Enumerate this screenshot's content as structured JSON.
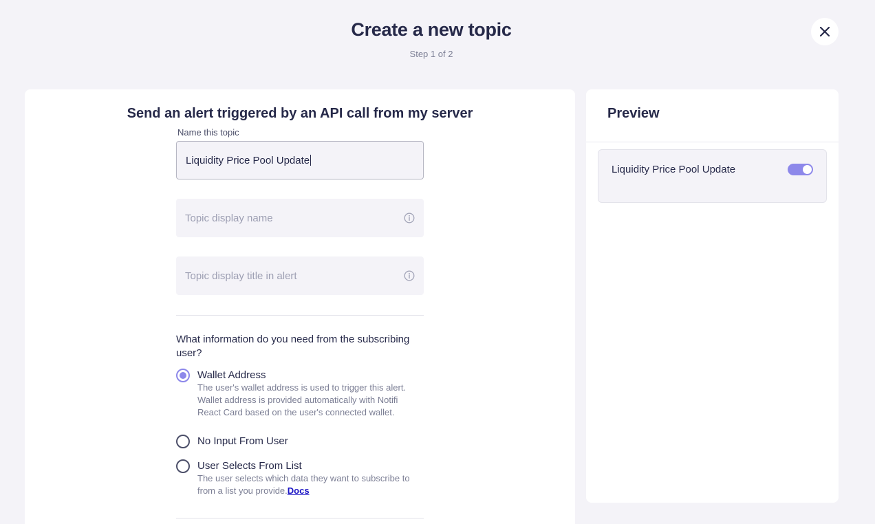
{
  "header": {
    "title": "Create a new topic",
    "step": "Step 1 of 2",
    "close_icon": "close-icon"
  },
  "form": {
    "title": "Send an alert triggered by an API call from my server",
    "name_label": "Name this topic",
    "name_value": "Liquidity Price Pool Update",
    "display_name_placeholder": "Topic display name",
    "display_title_placeholder": "Topic display title in alert",
    "info_icon": "info-icon",
    "question": "What information do you need from the subscribing user?",
    "options": [
      {
        "label": "Wallet Address",
        "desc_lines": [
          "The user's wallet address is used to trigger this alert.",
          "Wallet address is provided automatically with Notifi",
          "React Card based on the user's connected wallet."
        ],
        "checked": true
      },
      {
        "label": "No Input From User",
        "checked": false
      },
      {
        "label": "User Selects From List",
        "desc_lines": [
          "The user selects which data they want to subscribe to",
          "from a list you provide."
        ],
        "link": "Docs",
        "checked": false
      }
    ]
  },
  "preview": {
    "title": "Preview",
    "item_label": "Liquidity Price Pool Update",
    "toggle_on": true
  },
  "colors": {
    "accent": "#8d88ea",
    "background": "#f4f3f8",
    "text": "#262949",
    "link": "#1a13c4"
  }
}
